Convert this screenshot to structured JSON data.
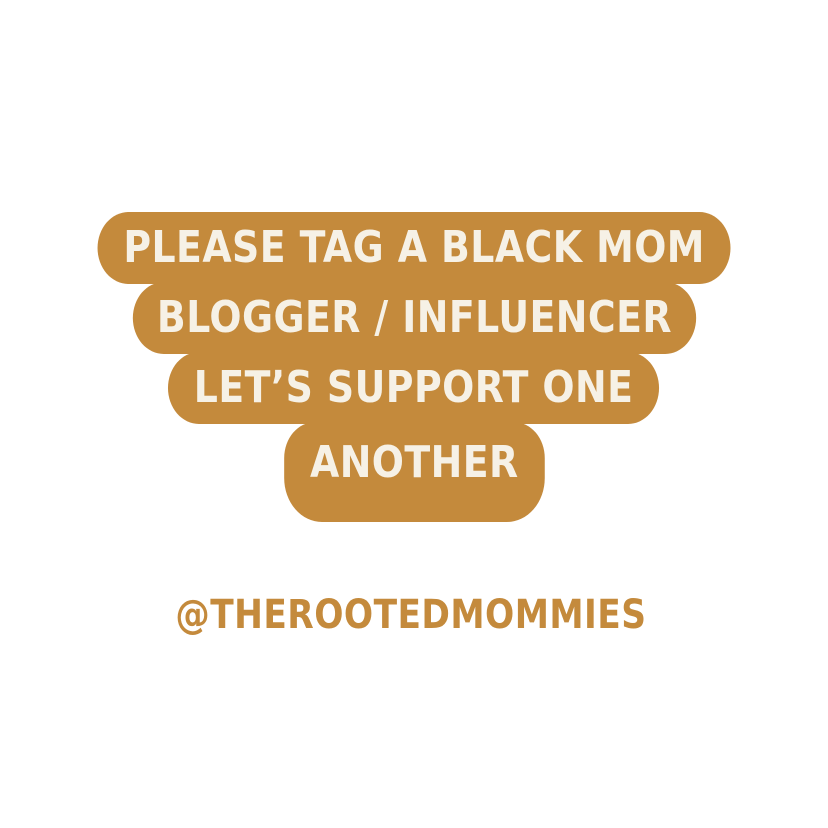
{
  "message": {
    "lines": [
      "PLEASE TAG A BLACK MOM",
      "BLOGGER / INFLUENCER",
      "LET’S SUPPORT ONE",
      "ANOTHER"
    ]
  },
  "handle": "@THEROOTEDMOMMIES",
  "colors": {
    "accent": "#c48a3c",
    "bubble_text": "#f6f1e6",
    "background": "#ffffff"
  }
}
